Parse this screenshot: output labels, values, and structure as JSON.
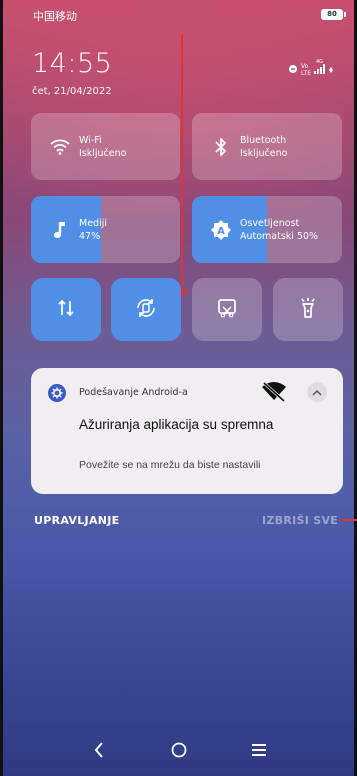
{
  "status_bar": {
    "carrier": "中国移动",
    "battery": "80",
    "network_vo": "Vo",
    "network_lte": "LTE",
    "network_4g": "4G"
  },
  "header": {
    "time": "14:55",
    "date": "čet, 21/04/2022"
  },
  "quick_settings": {
    "wifi": {
      "title": "Wi-Fi",
      "state": "Isključeno",
      "icon": "wifi-icon"
    },
    "bluetooth": {
      "title": "Bluetooth",
      "state": "Isključeno",
      "icon": "bluetooth-icon"
    },
    "media": {
      "title": "Mediji",
      "value": "47%",
      "level": 0.47,
      "icon": "music-note-icon"
    },
    "brightness": {
      "title": "Osvetljenost",
      "value": "Automatski 50%",
      "level": 0.5,
      "icon": "brightness-auto-icon"
    },
    "toggles": [
      {
        "name": "mobile-data",
        "icon": "data-transfer-icon",
        "active": true
      },
      {
        "name": "auto-rotate",
        "icon": "rotate-icon",
        "active": true
      },
      {
        "name": "screenshot",
        "icon": "screenshot-icon",
        "active": false
      },
      {
        "name": "flashlight",
        "icon": "flashlight-icon",
        "active": false
      }
    ]
  },
  "notification": {
    "app_name": "Podešavanje Android-a",
    "title": "Ažuriranja aplikacija su spremna",
    "body": "Povežite se na mrežu da biste nastavili"
  },
  "actions": {
    "manage": "UPRAVLJANJE",
    "clear_all": "IZBRIŠI SVE"
  },
  "colors": {
    "accent": "#4f8fe6",
    "annotation": "#d9353e"
  }
}
